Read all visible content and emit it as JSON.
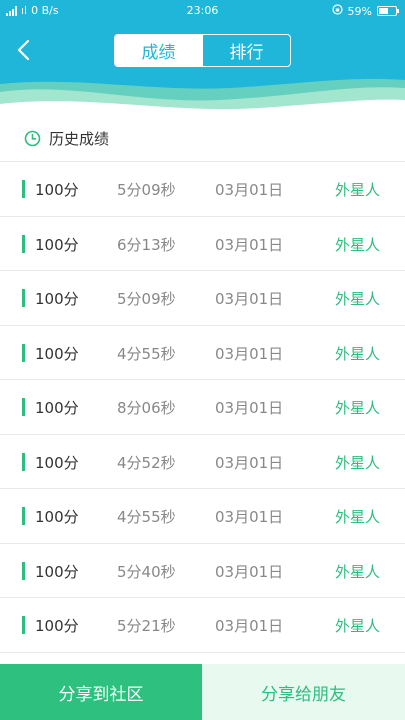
{
  "status_bar": {
    "carrier": "°",
    "signal_text": "ıl",
    "network_speed": "0 B/s",
    "time": "23:06",
    "battery_percent": "59%",
    "battery_level": 0.59
  },
  "header": {
    "tabs": [
      {
        "label": "成绩",
        "active": true
      },
      {
        "label": "排行",
        "active": false
      }
    ],
    "colors": {
      "header_bg": "#1fb6da",
      "accent": "#2dbd7e"
    }
  },
  "history": {
    "title": "历史成绩",
    "rows": [
      {
        "score": "100分",
        "time": "5分09秒",
        "date": "03月01日",
        "name": "外星人"
      },
      {
        "score": "100分",
        "time": "6分13秒",
        "date": "03月01日",
        "name": "外星人"
      },
      {
        "score": "100分",
        "time": "5分09秒",
        "date": "03月01日",
        "name": "外星人"
      },
      {
        "score": "100分",
        "time": "4分55秒",
        "date": "03月01日",
        "name": "外星人"
      },
      {
        "score": "100分",
        "time": "8分06秒",
        "date": "03月01日",
        "name": "外星人"
      },
      {
        "score": "100分",
        "time": "4分52秒",
        "date": "03月01日",
        "name": "外星人"
      },
      {
        "score": "100分",
        "time": "4分55秒",
        "date": "03月01日",
        "name": "外星人"
      },
      {
        "score": "100分",
        "time": "5分40秒",
        "date": "03月01日",
        "name": "外星人"
      },
      {
        "score": "100分",
        "time": "5分21秒",
        "date": "03月01日",
        "name": "外星人"
      }
    ]
  },
  "bottom_bar": {
    "share_community": "分享到社区",
    "share_friends": "分享给朋友"
  }
}
